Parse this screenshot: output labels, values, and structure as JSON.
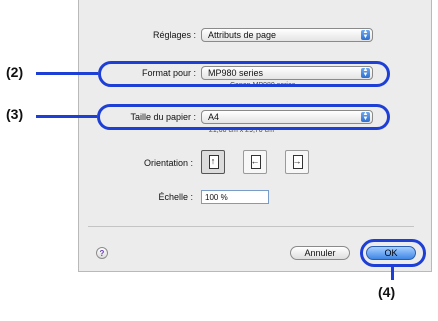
{
  "dialog": {
    "settings_label": "Réglages :",
    "settings_value": "Attributs de page",
    "format_label": "Format pour :",
    "format_value": "MP980 series",
    "format_note": "Canon MP980 series",
    "paper_label": "Taille du papier :",
    "paper_value": "A4",
    "paper_note": "21,00 cm x 29,70 cm",
    "orientation_label": "Orientation :",
    "scale_label": "Échelle :",
    "scale_value": "100 %",
    "help_label": "?",
    "cancel_label": "Annuler",
    "ok_label": "OK"
  },
  "icons": {
    "popup_arrows": "updown-chevron-icon",
    "orientation_portrait": "portrait-icon",
    "orientation_landscape_left": "landscape-left-icon",
    "orientation_landscape_right": "landscape-right-icon",
    "help": "help-icon"
  },
  "callouts": {
    "c2": "(2)",
    "c3": "(3)",
    "c4": "(4)"
  },
  "colors": {
    "callout_ring": "#1e3fd6",
    "default_button": "#3f87e6",
    "popup_arrows": "#2e6fd0"
  }
}
